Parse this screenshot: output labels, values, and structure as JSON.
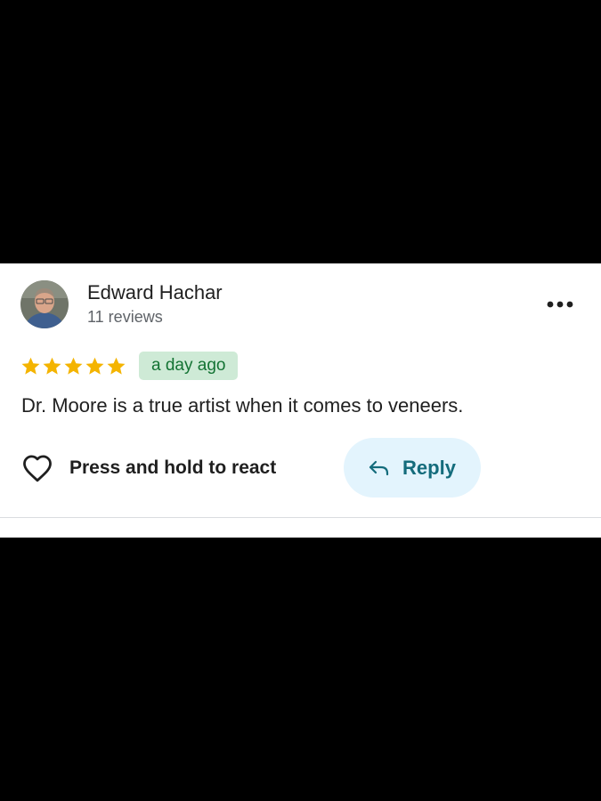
{
  "review": {
    "author": {
      "name": "Edward Hachar",
      "review_count": "11 reviews",
      "avatar": "profile-photo"
    },
    "rating": 5,
    "rating_max": 5,
    "time_ago": "a day ago",
    "text": "Dr. Moore is a true artist when it comes to veneers.",
    "actions": {
      "react_label": "Press and hold to react",
      "react_icon": "heart-outline-icon",
      "reply_label": "Reply",
      "reply_icon": "reply-arrow-icon",
      "more_icon": "more-dots-icon"
    }
  },
  "colors": {
    "star": "#f4b400",
    "badge_background": "#ceead6",
    "badge_text": "#137333",
    "reply_background": "#e3f4fd",
    "reply_text": "#146c7c"
  }
}
